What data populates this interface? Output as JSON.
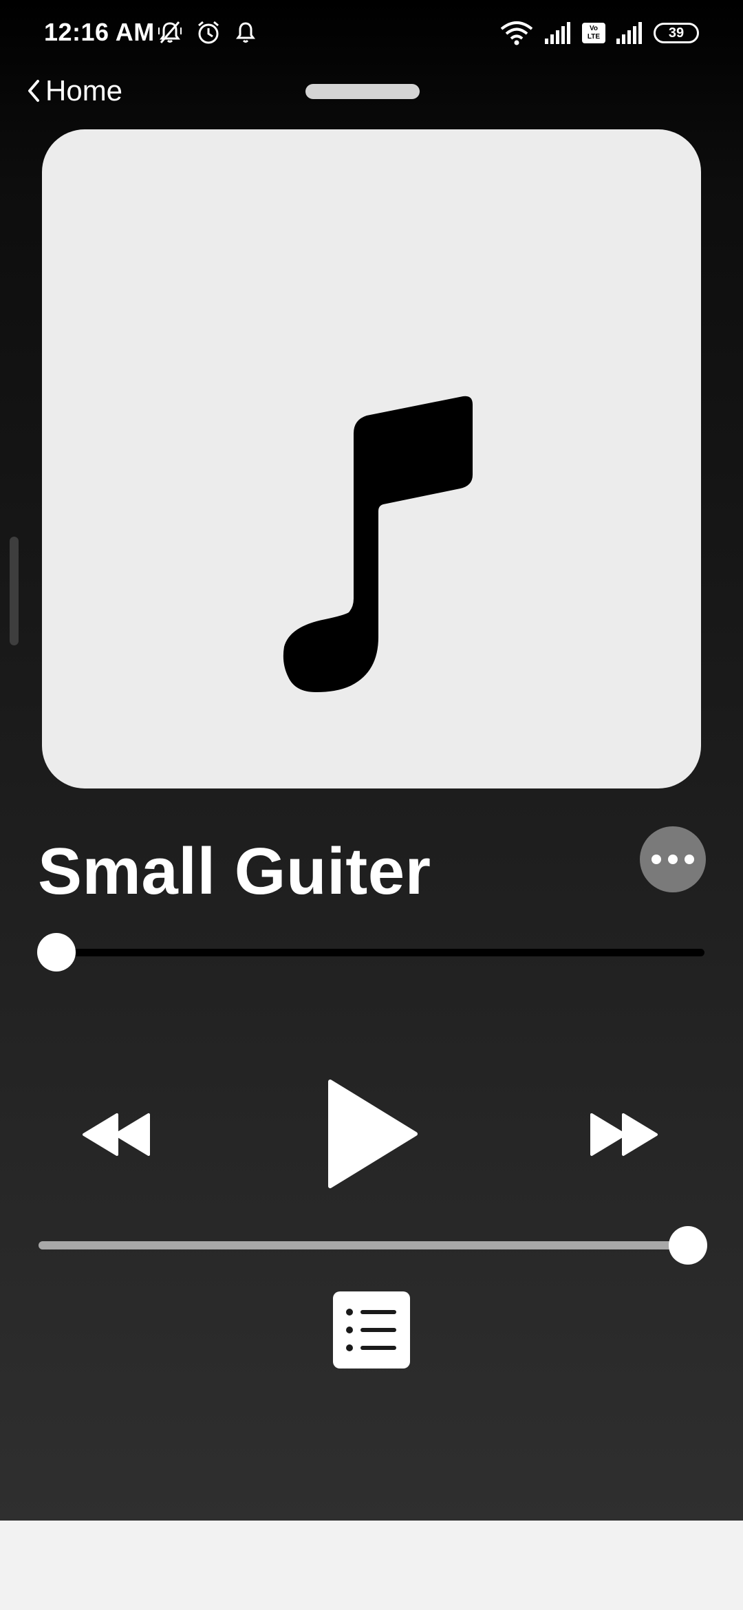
{
  "status_bar": {
    "time": "12:16 AM",
    "battery_level": "39",
    "volte_top": "Vo",
    "volte_bottom": "LTE",
    "left_icons": [
      "vibrate-off-bell-icon",
      "alarm-clock-icon",
      "notification-bell-icon"
    ],
    "right_icons": [
      "wifi-icon",
      "signal-bars-icon",
      "volte-icon",
      "signal-bars-icon",
      "battery-icon"
    ]
  },
  "header": {
    "back_label": "Home"
  },
  "player": {
    "artwork_icon": "music-note-icon",
    "track_title": "Small Guiter",
    "progress": 0.0,
    "volume": 1.0,
    "controls": [
      "rewind-icon",
      "play-icon",
      "fast-forward-icon"
    ],
    "queue_icon": "list-icon",
    "more_icon": "ellipsis-icon"
  },
  "colors": {
    "background_top": "#000000",
    "background_bottom": "#2f2f2f",
    "artwork_bg": "#ececec",
    "accent": "#ffffff",
    "more_button_bg": "#7a7a7a",
    "volume_fill": "#a8a8a8"
  }
}
